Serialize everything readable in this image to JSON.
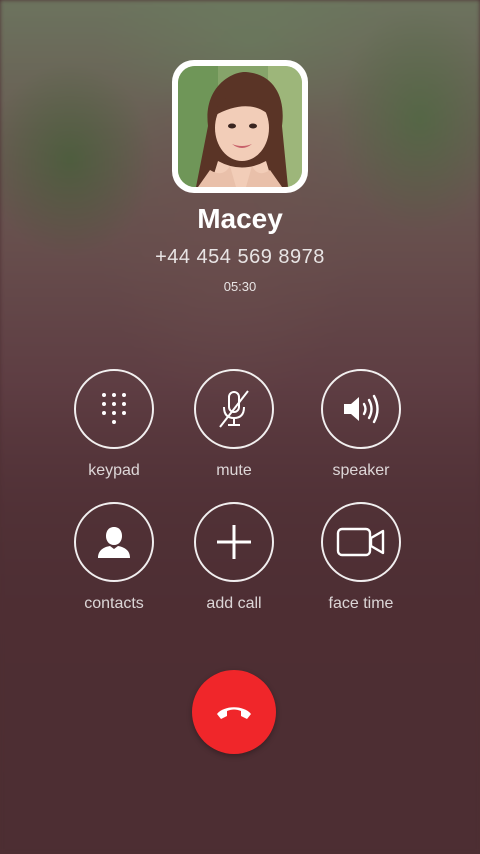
{
  "caller": {
    "name": "Macey",
    "number": "+44 454 569 8978",
    "duration": "05:30",
    "avatar_icon": "caller-photo"
  },
  "controls": {
    "keypad": {
      "label": "keypad",
      "icon": "keypad-icon"
    },
    "mute": {
      "label": "mute",
      "icon": "mic-off-icon"
    },
    "speaker": {
      "label": "speaker",
      "icon": "speaker-icon"
    },
    "contacts": {
      "label": "contacts",
      "icon": "person-icon"
    },
    "add_call": {
      "label": "add call",
      "icon": "plus-icon"
    },
    "face_time": {
      "label": "face time",
      "icon": "video-camera-icon"
    }
  },
  "end_call": {
    "icon": "phone-hangup-icon",
    "color": "#f0262a"
  },
  "colors": {
    "background": "#4d2f33",
    "text": "#ffffff",
    "end_call": "#f0262a"
  }
}
